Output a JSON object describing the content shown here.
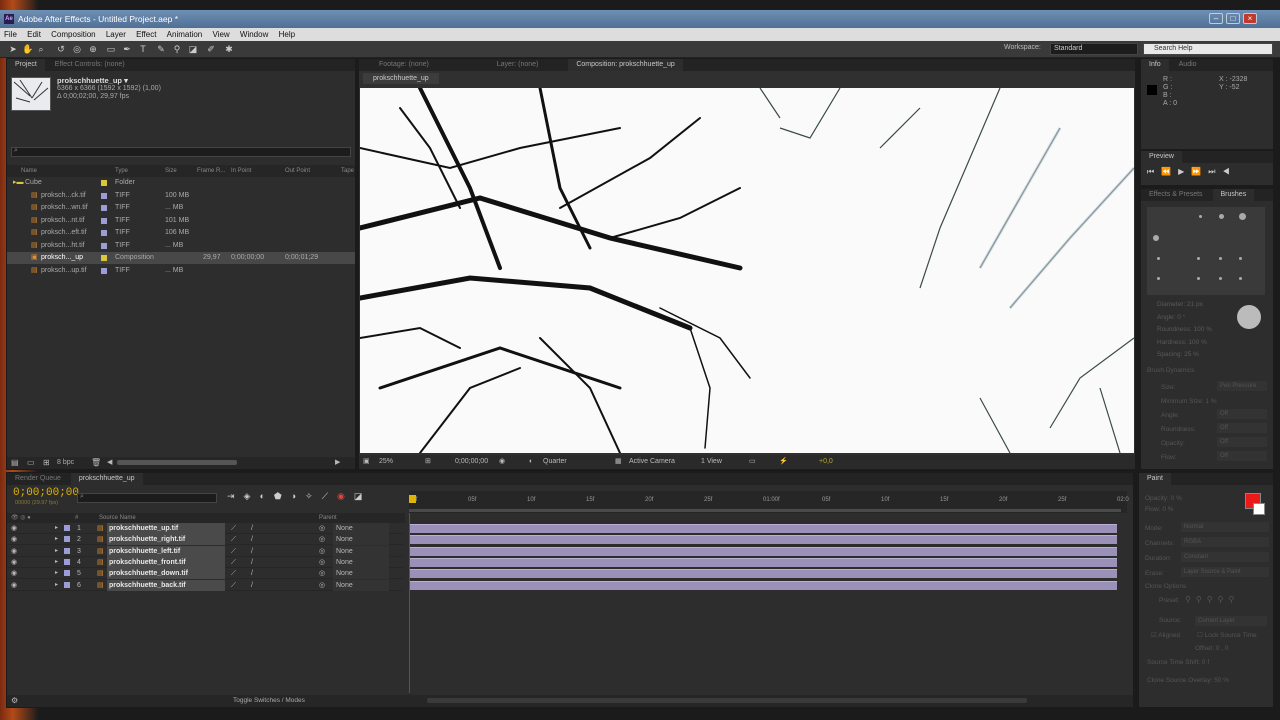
{
  "app": {
    "title": "Adobe After Effects - Untitled Project.aep *",
    "icon": "Ae"
  },
  "menu": [
    "File",
    "Edit",
    "Composition",
    "Layer",
    "Effect",
    "Animation",
    "View",
    "Window",
    "Help"
  ],
  "toolbar": {
    "workspace_label": "Workspace:",
    "workspace_value": "Standard",
    "search_placeholder": "Search Help"
  },
  "project": {
    "tabs": [
      "Project",
      "Effect Controls: (none)"
    ],
    "item_name": "prokschhuette_up ▾",
    "item_info_1": "6366 x 6366  (1592 x 1592) (1,00)",
    "item_info_2": "Δ 0;00;02;00, 29,97 fps",
    "columns": [
      "Name",
      "Type",
      "Size",
      "Frame R...",
      "In Point",
      "Out Point",
      "Tape"
    ],
    "items": [
      {
        "name": "Cube",
        "type": "Folder",
        "size": "",
        "fps": "",
        "in": "",
        "out": "",
        "color": "#d9c63a"
      },
      {
        "name": "proksch...ck.tif",
        "type": "TIFF",
        "size": "100 MB",
        "fps": "",
        "in": "",
        "out": "",
        "color": "#9c9cd6"
      },
      {
        "name": "proksch...wn.tif",
        "type": "TIFF",
        "size": "... MB",
        "fps": "",
        "in": "",
        "out": "",
        "color": "#9c9cd6"
      },
      {
        "name": "proksch...nt.tif",
        "type": "TIFF",
        "size": "101 MB",
        "fps": "",
        "in": "",
        "out": "",
        "color": "#9c9cd6"
      },
      {
        "name": "proksch...eft.tif",
        "type": "TIFF",
        "size": "106 MB",
        "fps": "",
        "in": "",
        "out": "",
        "color": "#9c9cd6"
      },
      {
        "name": "proksch...ht.tif",
        "type": "TIFF",
        "size": "... MB",
        "fps": "",
        "in": "",
        "out": "",
        "color": "#9c9cd6"
      },
      {
        "name": "proksch..._up",
        "type": "Composition",
        "size": "",
        "fps": "29,97",
        "in": "0;00;00;00",
        "out": "0;00;01;29",
        "color": "#d9c63a"
      },
      {
        "name": "proksch...up.tif",
        "type": "TIFF",
        "size": "... MB",
        "fps": "",
        "in": "",
        "out": "",
        "color": "#9c9cd6"
      }
    ],
    "bpc": "8 bpc"
  },
  "viewer": {
    "tabs": [
      "Footage: (none)",
      "Layer: (none)",
      "Composition: prokschhuette_up"
    ],
    "subtab": "prokschhuette_up",
    "zoom": "25%",
    "timecode": "0;00;00;00",
    "resolution": "Quarter",
    "camera": "Active Camera",
    "views": "1 View",
    "exposure": "+0,0"
  },
  "info": {
    "tabs": [
      "Info",
      "Audio"
    ],
    "r": "R :",
    "g": "G :",
    "b": "B :",
    "a": "A : 0",
    "x": "X : -2328",
    "y": "Y : -52"
  },
  "preview": {
    "tab": "Preview"
  },
  "brushes": {
    "tabs": [
      "Effects & Presets",
      "Brushes"
    ],
    "props": [
      "Diameter: 21 px",
      "Angle: 0 °",
      "Roundness: 100 %",
      "Hardness: 100 %",
      "Spacing: 25 %"
    ],
    "dynamics": "Brush Dynamics",
    "dyn_rows": [
      "Size:",
      "Minimum Size: 1 %",
      "Angle:",
      "Roundness:",
      "Opacity:",
      "Flow:"
    ],
    "off": "Off",
    "pen_pressure": "Pen Pressure"
  },
  "paint": {
    "tab": "Paint",
    "opacity": "Opacity: 0 %",
    "flow": "Flow: 0 %",
    "mode": "Mode:",
    "mode_value": "Normal",
    "channels": "Channels:",
    "channels_value": "RGBA",
    "duration": "Duration:",
    "duration_value": "Constant",
    "erase": "Erase:",
    "erase_value": "Layer Source & Paint",
    "clone_options": "Clone Options",
    "preset": "Preset:",
    "source": "Source:",
    "source_value": "Current Layer",
    "aligned": "Aligned",
    "lock_source": "Lock Source Time",
    "offset": "Offset: 0 , 0",
    "source_time": "Source Time Shift: 0 f",
    "overlay": "Clone Source Overlay: 50 %",
    "fg_color": "#e81a1a",
    "bg_color": "#ffffff"
  },
  "timeline": {
    "tabs": [
      "Render Queue",
      "prokschhuette_up"
    ],
    "timecode": "0;00;00;00",
    "sub_timecode": "00000 (29.97 fps)",
    "columns": [
      "#",
      "Source Name",
      "Parent"
    ],
    "layers": [
      {
        "num": "1",
        "name": "prokschhuette_up.tif",
        "parent": "None"
      },
      {
        "num": "2",
        "name": "prokschhuette_right.tif",
        "parent": "None"
      },
      {
        "num": "3",
        "name": "prokschhuette_left.tif",
        "parent": "None"
      },
      {
        "num": "4",
        "name": "prokschhuette_front.tif",
        "parent": "None"
      },
      {
        "num": "5",
        "name": "prokschhuette_down.tif",
        "parent": "None"
      },
      {
        "num": "6",
        "name": "prokschhuette_back.tif",
        "parent": "None"
      }
    ],
    "ruler": [
      "00f",
      "05f",
      "10f",
      "15f",
      "20f",
      "25f",
      "01:00f",
      "05f",
      "10f",
      "15f",
      "20f",
      "25f",
      "02:0"
    ],
    "toggle_label": "Toggle Switches / Modes"
  }
}
